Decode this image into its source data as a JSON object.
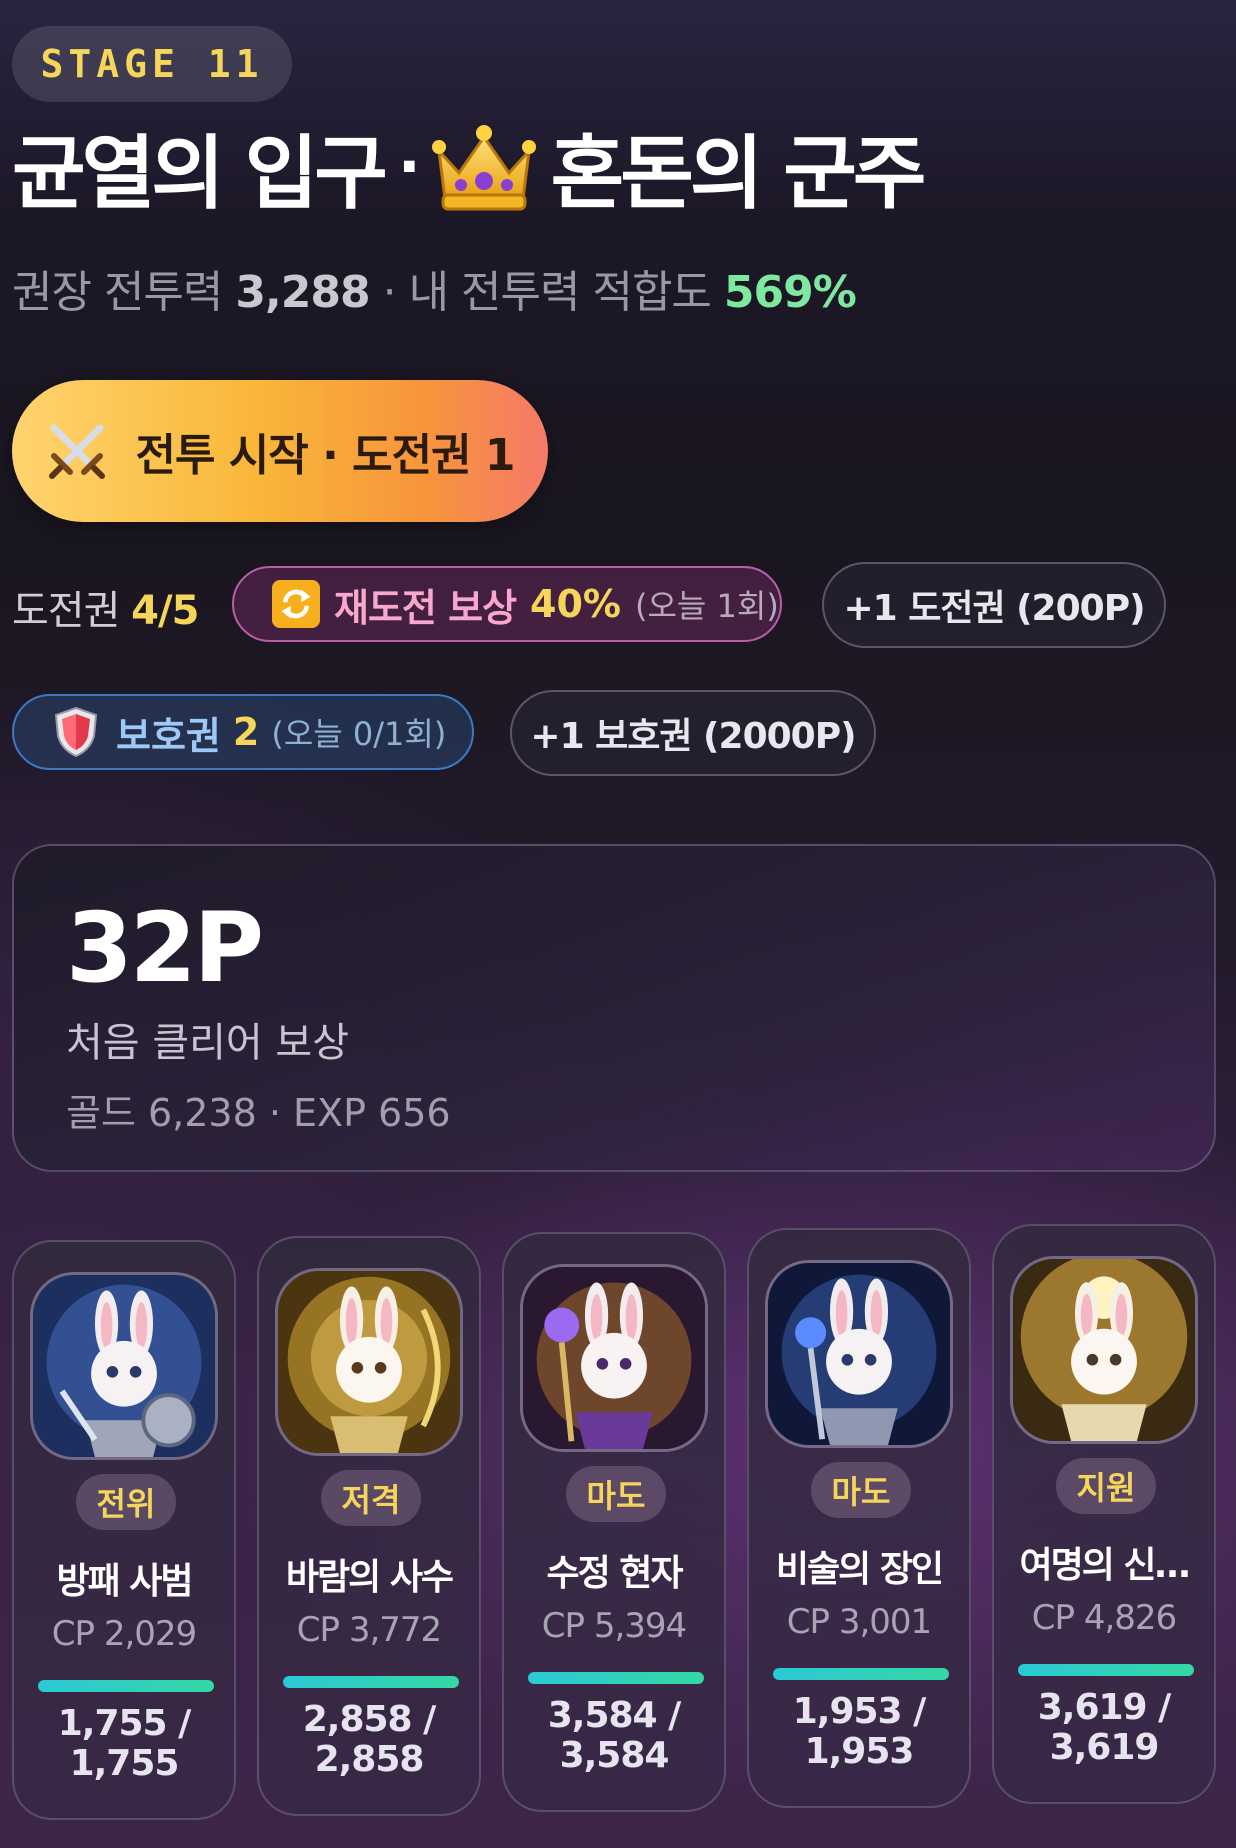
{
  "stage": {
    "label": "STAGE 11"
  },
  "title": {
    "part1": "균열의 입구",
    "separator": "·",
    "crown_icon": "crown-icon",
    "part2": "혼돈의 군주"
  },
  "power": {
    "recommended_label": "권장 전투력",
    "recommended_value": "3,288",
    "separator": "·",
    "fit_label": "내 전투력 적합도",
    "fit_value": "569%"
  },
  "battle_button": {
    "label": "전투 시작 · 도전권 1",
    "icon": "crossed-swords-icon"
  },
  "tickets": {
    "label": "도전권",
    "value": "4/5"
  },
  "retry_bonus": {
    "icon": "repeat-icon",
    "label": "재도전 보상",
    "value": "40%",
    "note": "(오늘 1회)"
  },
  "buy_ticket": {
    "label": "+1 도전권 (200P)"
  },
  "shield": {
    "icon": "shield-icon",
    "label": "보호권",
    "value": "2",
    "note": "(오늘 0/1회)"
  },
  "buy_shield": {
    "label": "+1 보호권 (2000P)"
  },
  "reward": {
    "points": "32P",
    "label": "처음 클리어 보상",
    "detail": "골드 6,238 · EXP 656"
  },
  "colors": {
    "accent_yellow": "#f5d55a",
    "accent_green": "#7ee8a0",
    "button_orange": "#f9b73a"
  },
  "heroes": [
    {
      "role": "전위",
      "name": "방패 사범",
      "cp": "CP 2,029",
      "hp_line1": "1,755 /",
      "hp_line2": "1,755",
      "hp_fraction": 1.0
    },
    {
      "role": "저격",
      "name": "바람의 사수",
      "cp": "CP 3,772",
      "hp_line1": "2,858 /",
      "hp_line2": "2,858",
      "hp_fraction": 1.0
    },
    {
      "role": "마도",
      "name": "수정 현자",
      "cp": "CP 5,394",
      "hp_line1": "3,584 /",
      "hp_line2": "3,584",
      "hp_fraction": 1.0
    },
    {
      "role": "마도",
      "name": "비술의 장인",
      "cp": "CP 3,001",
      "hp_line1": "1,953 /",
      "hp_line2": "1,953",
      "hp_fraction": 1.0
    },
    {
      "role": "지원",
      "name": "여명의 신…",
      "cp": "CP 4,826",
      "hp_line1": "3,619 /",
      "hp_line2": "3,619",
      "hp_fraction": 1.0
    }
  ]
}
